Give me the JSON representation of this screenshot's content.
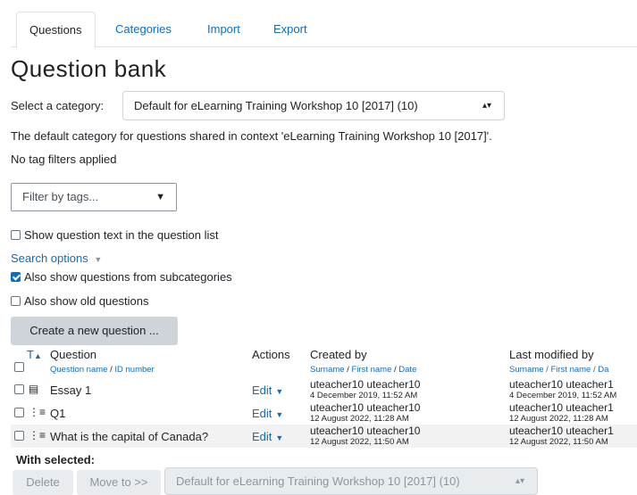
{
  "tabs": [
    "Questions",
    "Categories",
    "Import",
    "Export"
  ],
  "page_title": "Question bank",
  "category_select": {
    "label": "Select a category:",
    "value": "Default for eLearning Training Workshop 10 [2017] (10)"
  },
  "context_text": "The default category for questions shared in context 'eLearning Training Workshop 10 [2017]'.",
  "tag_filters_text": "No tag filters applied",
  "filter_placeholder": "Filter by tags...",
  "show_question_text_label": "Show question text in the question list",
  "search_options_label": "Search options",
  "subcategories_label": "Also show questions from subcategories",
  "old_questions_label": "Also show old questions",
  "create_button": "Create a new question ...",
  "table": {
    "header_type": "T",
    "header_question": "Question",
    "header_actions": "Actions",
    "header_created": "Created by",
    "header_modified": "Last modified by",
    "sub_question_name": "Question name",
    "sub_slash": " / ",
    "sub_id_number": "ID number",
    "sub_surname": "Surname",
    "sub_first_name": "First name",
    "sub_date": "Date",
    "sub_modified_prefix": "Surname / First name / Da",
    "rows": [
      {
        "name": "Essay 1",
        "icon": "essay-icon",
        "action": "Edit",
        "created_by": "uteacher10 uteacher10",
        "created_date": "4 December 2019, 11:52 AM",
        "modified_by": "uteacher10 uteacher1",
        "modified_date": "4 December 2019, 11:52 AM"
      },
      {
        "name": "Q1",
        "icon": "multichoice-icon",
        "action": "Edit",
        "created_by": "uteacher10 uteacher10",
        "created_date": "12 August 2022, 11:28 AM",
        "modified_by": "uteacher10 uteacher1",
        "modified_date": "12 August 2022, 11:28 AM"
      },
      {
        "name": "What is the capital of Canada?",
        "icon": "multichoice-icon",
        "action": "Edit",
        "created_by": "uteacher10 uteacher10",
        "created_date": "12 August 2022, 11:50 AM",
        "modified_by": "uteacher10 uteacher1",
        "modified_date": "12 August 2022, 11:50 AM"
      }
    ]
  },
  "with_selected": "With selected:",
  "delete_button": "Delete",
  "move_to_button": "Move to >>",
  "move_to_select": "Default for eLearning Training Workshop 10 [2017] (10)"
}
